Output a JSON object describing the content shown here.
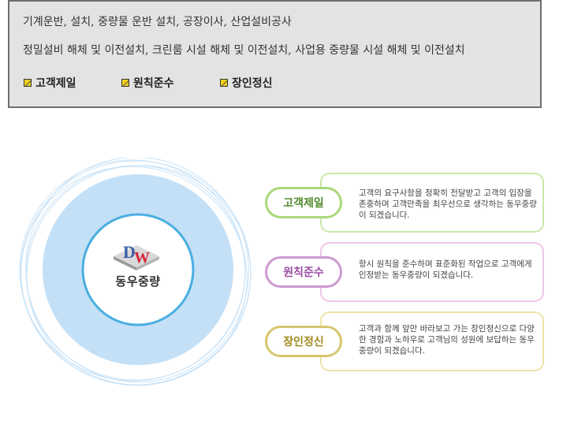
{
  "info": {
    "line1": "기계운반, 설치, 중량물 운반 설치, 공장이사, 산업설비공사",
    "line2": "정밀설비 해체 및 이전설치, 크린룸 시설 해체 및 이전설치, 사업용 중량물 시설 해체 및 이전설치",
    "values": [
      "고객제일",
      "원칙준수",
      "장인정신"
    ]
  },
  "graphic": {
    "logo_text": "DW",
    "company": "동우중량"
  },
  "rows": [
    {
      "label": "고객제일",
      "desc": "고객의 요구사항을 정확히 전달받고 고객의 입장을 존중하며 고객만족을 최우선으로 생각하는 동우중량이 되겠습니다."
    },
    {
      "label": "원칙준수",
      "desc": "항시 원칙을 준수하며 표준화된 작업으로 고객에게 인정받는 동우중량이 되겠습니다."
    },
    {
      "label": "장인정신",
      "desc": "고객과 함께 앞만 바라보고 가는 장인정신으로 다양한 경험과 노하우로 고객님의 성원에 보답하는 동우중량이 되겠습니다."
    }
  ],
  "colors": {
    "value1": "#4f8a2a",
    "value2": "#9c4da3",
    "value3": "#a08a1e",
    "circle_fill": "#c3e0f7",
    "ring": "#4aaee0"
  }
}
